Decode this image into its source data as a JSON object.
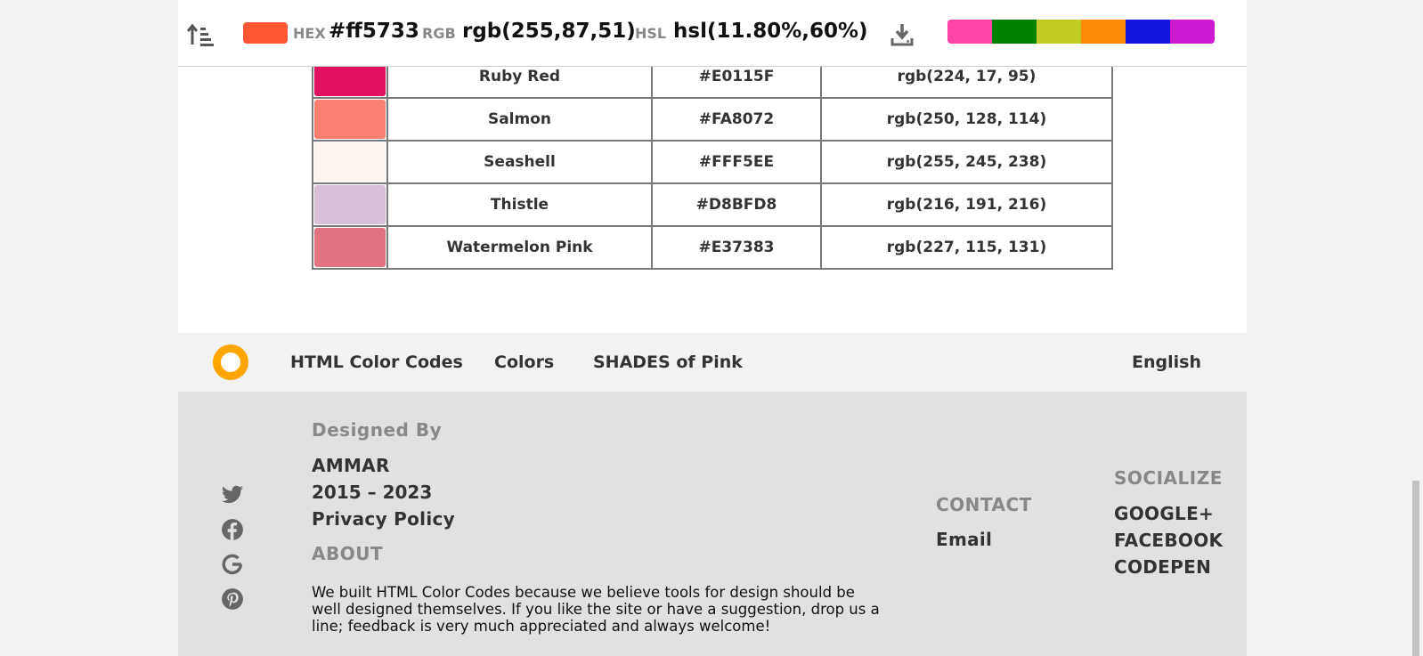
{
  "topbar": {
    "current_color": "#ff5733",
    "hex_label": "HEX",
    "hex_value": "#ff5733",
    "rgb_label": "RGB",
    "rgb_value": "rgb(255,87,51)",
    "hsl_label": "HSL",
    "hsl_value": "hsl(11.80%,60%)",
    "sort_icon": "sort-ascending-icon",
    "download_icon": "download-icon",
    "palette": [
      "#ff44a8",
      "#008000",
      "#c1cd23",
      "#ff8a08",
      "#1616e0",
      "#cc1bd1"
    ]
  },
  "table": {
    "rows": [
      {
        "color": "#E0115F",
        "name": "Ruby Red",
        "hex": "#E0115F",
        "rgb": "rgb(224, 17, 95)"
      },
      {
        "color": "#FA8072",
        "name": "Salmon",
        "hex": "#FA8072",
        "rgb": "rgb(250, 128, 114)"
      },
      {
        "color": "#FFF5EE",
        "name": "Seashell",
        "hex": "#FFF5EE",
        "rgb": "rgb(255, 245, 238)"
      },
      {
        "color": "#D8BFD8",
        "name": "Thistle",
        "hex": "#D8BFD8",
        "rgb": "rgb(216, 191, 216)"
      },
      {
        "color": "#E37383",
        "name": "Watermelon Pink",
        "hex": "#E37383",
        "rgb": "rgb(227, 115, 131)"
      }
    ]
  },
  "nav": {
    "logo_icon": "ring-logo-icon",
    "links": [
      "HTML Color Codes",
      "Colors",
      "SHADES of Pink"
    ],
    "language": "English"
  },
  "footer": {
    "social_icons": [
      "twitter-icon",
      "facebook-icon",
      "google-icon",
      "pinterest-icon"
    ],
    "designed_by_heading": "Designed By",
    "designer": "AMMAR",
    "years": "2015 – 2023",
    "privacy": "Privacy Policy",
    "about_heading": "ABOUT",
    "about_text": "We built HTML Color Codes because we believe tools for design should be well designed themselves. If you like the site or have a suggestion, drop us a line; feedback is very much appreciated and always welcome!",
    "contact_heading": "CONTACT",
    "email": "Email",
    "socialize_heading": "SOCIALIZE",
    "socialize_links": [
      "GOOGLE+",
      "FACEBOOK",
      "CODEPEN"
    ]
  }
}
